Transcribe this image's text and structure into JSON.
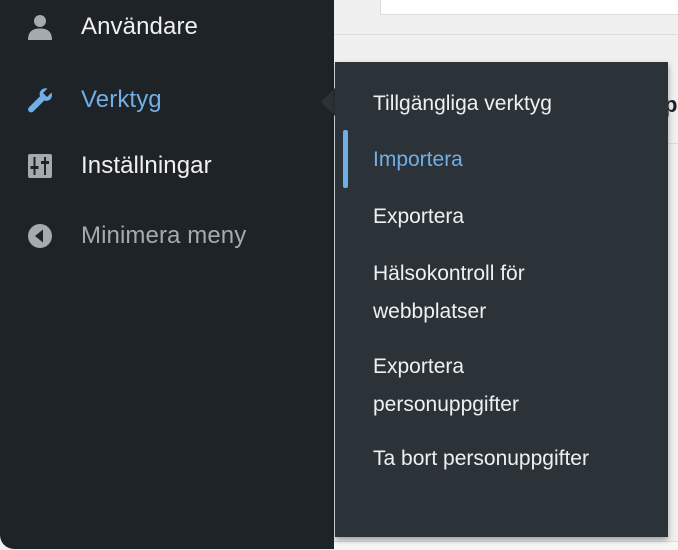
{
  "sidebar": {
    "items": [
      {
        "label": "Användare",
        "icon": "user-icon"
      },
      {
        "label": "Verktyg",
        "icon": "wrench-icon"
      },
      {
        "label": "Inställningar",
        "icon": "settings-sliders-icon"
      },
      {
        "label": "Minimera meny",
        "icon": "collapse-arrow-icon"
      }
    ]
  },
  "submenu": {
    "items": [
      {
        "label": "Tillgängliga verktyg"
      },
      {
        "label": "Importera",
        "current": true
      },
      {
        "label": "Exportera"
      },
      {
        "label": "Hälsokontroll för webbplatser"
      },
      {
        "label": "Exportera personuppgifter"
      },
      {
        "label": "Ta bort personuppgifter"
      }
    ]
  },
  "colors": {
    "sidebar_bg": "#1d2327",
    "flyout_bg": "#2c3338",
    "accent": "#72aee6",
    "text": "#f0f0f1",
    "muted": "#a7aaad"
  }
}
